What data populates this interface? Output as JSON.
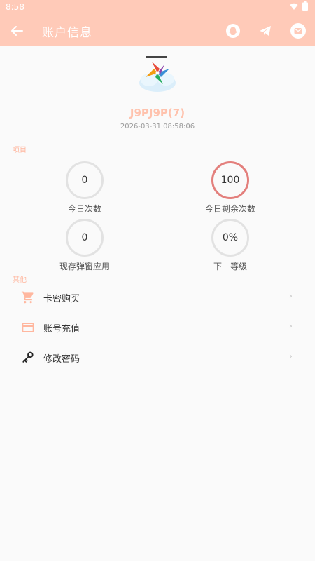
{
  "status_bar": {
    "time": "8:58"
  },
  "appbar": {
    "title": "账户信息"
  },
  "user": {
    "name": "J9PJ9P(7)",
    "timestamp": "2026-03-31 08:58:06"
  },
  "sections": {
    "project": "项目",
    "other": "其他"
  },
  "stats": [
    {
      "value": "0",
      "label": "今日次数"
    },
    {
      "value": "100",
      "label": "今日剩余次数"
    },
    {
      "value": "0",
      "label": "现存弹窗应用"
    },
    {
      "value": "0%",
      "label": "下一等级"
    }
  ],
  "menu": [
    {
      "label": "卡密购买",
      "icon": "cart-icon"
    },
    {
      "label": "账号充值",
      "icon": "credit-card-icon"
    },
    {
      "label": "修改密码",
      "icon": "key-icon"
    }
  ],
  "colors": {
    "accent": "#ffcab8",
    "highlight_ring": "#e37f7c",
    "section_label": "#ffb79f"
  }
}
